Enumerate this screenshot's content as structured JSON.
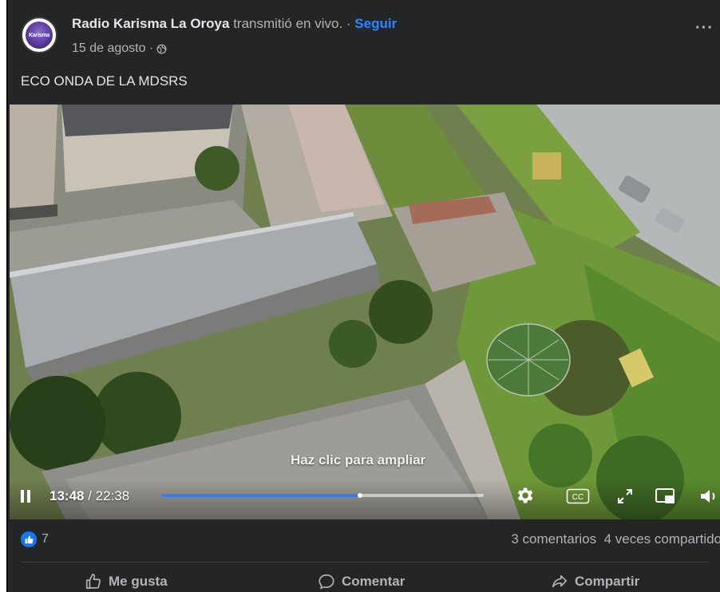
{
  "post": {
    "page_name": "Radio Karisma La Oroya",
    "action_text": " transmitió en vivo. · ",
    "follow_label": "Seguir",
    "date": "15 de agosto ·",
    "more_label": "···",
    "text": "ECO ONDA DE LA MDSRS",
    "avatar_text": "Karisma"
  },
  "video": {
    "overlay_text": "Haz clic para ampliar",
    "current_time": "13:48",
    "separator": " / ",
    "total_time": "22:38",
    "progress": 0.617,
    "paused": false
  },
  "reactions": {
    "like_count": "7",
    "comments": "3 comentarios",
    "shares": "4 veces compartido"
  },
  "actions": {
    "like": "Me gusta",
    "comment": "Comentar",
    "share": "Compartir"
  },
  "colors": {
    "background": "#242526",
    "accent": "#2d88ff",
    "progress": "#3b7be8",
    "like_badge": "#1877f2"
  }
}
